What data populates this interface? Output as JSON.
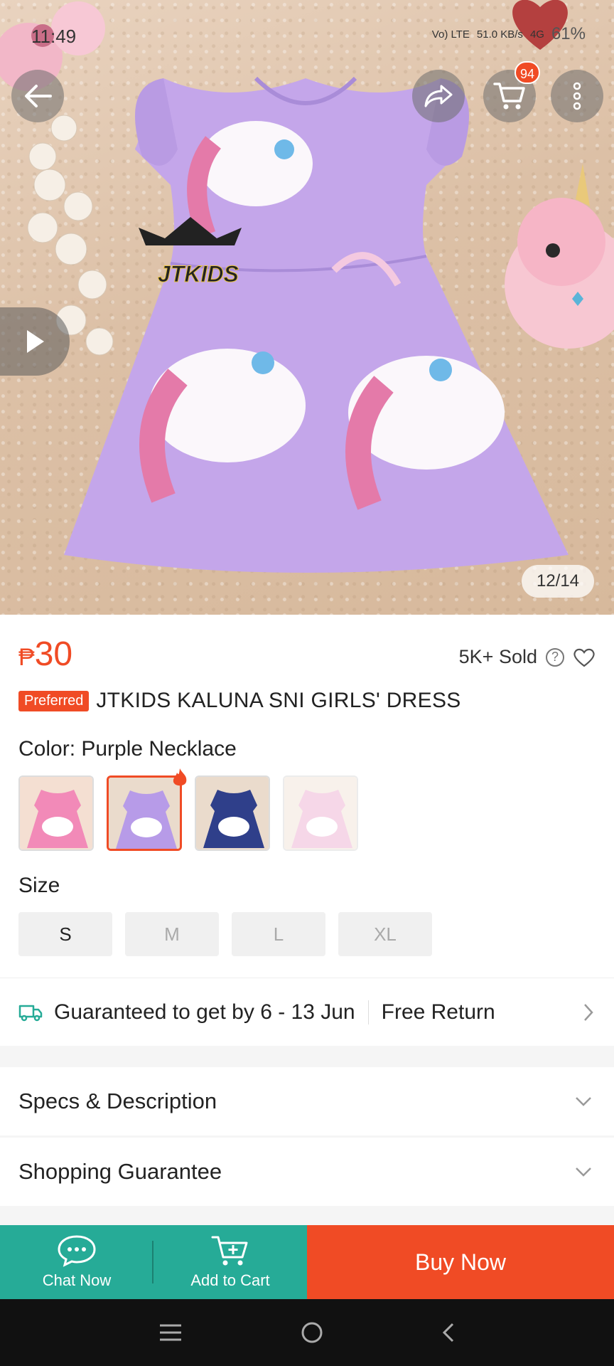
{
  "status_bar": {
    "time": "11:49",
    "network": "Vo) LTE",
    "speed": "51.0 KB/s",
    "signal": "4G",
    "battery": "61%"
  },
  "header": {
    "cart_count": "94"
  },
  "gallery": {
    "counter": "12/14"
  },
  "product": {
    "currency": "₱",
    "price": "30",
    "sold": "5K+ Sold",
    "preferred_badge": "Preferred",
    "title": "JTKIDS KALUNA SNI GIRLS' DRESS",
    "color_label": "Color: Purple Necklace",
    "colors": [
      {
        "name": "pink",
        "color": "#f28ab8",
        "selected": false
      },
      {
        "name": "purple",
        "color": "#b79be8",
        "selected": true
      },
      {
        "name": "navy",
        "color": "#2f3f8a",
        "selected": false
      },
      {
        "name": "light-pink",
        "color": "#efb8d6",
        "selected": false
      }
    ],
    "size_label": "Size",
    "sizes": [
      "S",
      "M",
      "L",
      "XL"
    ]
  },
  "delivery": {
    "text": "Guaranteed to get by 6 - 13 Jun",
    "return": "Free Return"
  },
  "sections": {
    "specs": "Specs & Description",
    "guarantee": "Shopping Guarantee"
  },
  "bottom_bar": {
    "chat": "Chat Now",
    "add_to_cart": "Add to Cart",
    "buy_now": "Buy Now"
  },
  "colors": {
    "accent": "#f04b25",
    "teal": "#26ab97"
  }
}
